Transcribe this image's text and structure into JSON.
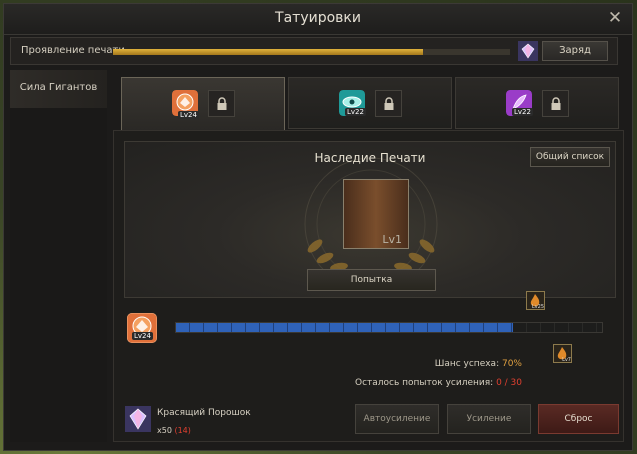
{
  "window": {
    "title": "Татуировки"
  },
  "manifest": {
    "label": "Проявление печати",
    "progress": 0.78,
    "charge_label": "Заряд"
  },
  "sidebar": {
    "items": [
      {
        "label": "Сила Гигантов"
      }
    ]
  },
  "tabs": [
    {
      "icon": "giant-tattoo-icon",
      "level": "Lv24",
      "color": "#e0703a",
      "active": true
    },
    {
      "icon": "eye-tattoo-icon",
      "level": "Lv22",
      "color": "#22a0a0",
      "active": false
    },
    {
      "icon": "feather-tattoo-icon",
      "level": "Lv22",
      "color": "#a040d0",
      "active": false
    }
  ],
  "seal": {
    "title": "Наследие Печати",
    "list_label": "Общий список",
    "level": "Lv1",
    "try_label": "Попытка"
  },
  "enhance": {
    "level": "Lv24",
    "progress": 0.79,
    "marker_top_level": "Lv25",
    "marker_bottom_level": "Lv7"
  },
  "stats": {
    "chance_label": "Шанс успеха:",
    "chance_value": "70%",
    "attempts_label": "Осталось попыток усиления:",
    "attempts_value": "0 / 30"
  },
  "material": {
    "name": "Красящий Порошок",
    "count": "x50",
    "owned": "(14)"
  },
  "buttons": {
    "auto": "Автоусиление",
    "enhance": "Усиление",
    "reset": "Сброс"
  }
}
